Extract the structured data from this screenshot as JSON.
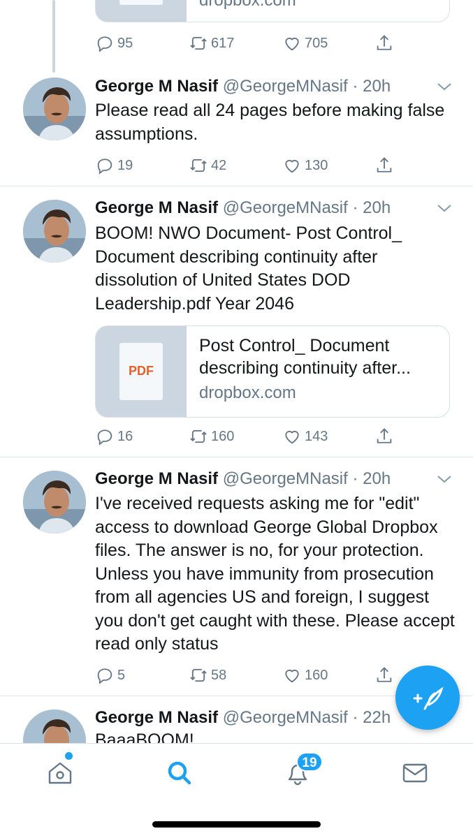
{
  "top_card": {
    "domain": "dropbox.com",
    "actions": {
      "replies": "95",
      "retweets": "617",
      "likes": "705"
    }
  },
  "tweets": [
    {
      "name": "George M Nasif",
      "handle": "@GeorgeMNasif",
      "time": "20h",
      "text": "Please read all 24 pages before making false assumptions.",
      "actions": {
        "replies": "19",
        "retweets": "42",
        "likes": "130"
      }
    },
    {
      "name": "George M Nasif",
      "handle": "@GeorgeMNasif",
      "time": "20h",
      "text": "BOOM! NWO Document- Post Control_ Document describing continuity after dissolution of United States DOD Leadership.pdf  Year 2046",
      "card": {
        "thumb_label": "PDF",
        "title": "Post Control_ Document describing continuity after...",
        "domain": "dropbox.com"
      },
      "actions": {
        "replies": "16",
        "retweets": "160",
        "likes": "143"
      }
    },
    {
      "name": "George M Nasif",
      "handle": "@GeorgeMNasif",
      "time": "20h",
      "text": "I've received requests asking me for \"edit\" access to download George Global Dropbox files. The answer is no, for your protection. Unless you have immunity from prosecution from all agencies US and foreign, I suggest you don't get caught with these. Please accept read only status",
      "actions": {
        "replies": "5",
        "retweets": "58",
        "likes": "160"
      }
    },
    {
      "name": "George M Nasif",
      "handle": "@GeorgeMNasif",
      "time": "22h",
      "text": "BaaaBOOM!"
    }
  ],
  "tabbar": {
    "notifications_badge": "19",
    "active_tab": "search",
    "icons": [
      "home-icon",
      "search-icon",
      "bell-icon",
      "mail-icon"
    ]
  },
  "colors": {
    "accent": "#1da1f2",
    "muted": "#657786",
    "divider": "#e1e8ed"
  }
}
